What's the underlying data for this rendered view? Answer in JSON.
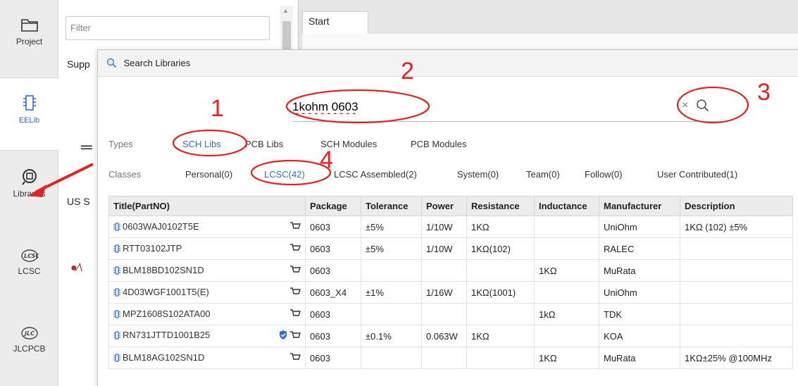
{
  "rail": {
    "items": [
      {
        "label": "Project",
        "icon": "folder-icon"
      },
      {
        "label": "EELib",
        "icon": "chip-icon"
      },
      {
        "label": "Libraries",
        "icon": "libraries-icon"
      },
      {
        "label": "LCSC",
        "icon": "lcsc-logo-icon"
      },
      {
        "label": "JLCPCB",
        "icon": "jlc-logo-icon"
      }
    ]
  },
  "left_panel": {
    "filter_placeholder": "Filter",
    "supp_text": "Supp",
    "uss_text": "US S"
  },
  "tabs": {
    "start": "Start"
  },
  "dialog": {
    "title": "Search Libraries",
    "search_value": "1kohm 0603",
    "clear_glyph": "×",
    "types_label": "Types",
    "types": [
      "SCH Libs",
      "PCB Libs",
      "SCH Modules",
      "PCB Modules"
    ],
    "selected_type": "SCH Libs",
    "classes_label": "Classes",
    "classes": [
      "Personal(0)",
      "LCSC(42)",
      "LCSC Assembled(2)",
      "System(0)",
      "Team(0)",
      "Follow(0)",
      "User Contributed(1)"
    ],
    "selected_class": "LCSC(42)",
    "accent": "#2f6fd8"
  },
  "table": {
    "headers": [
      "Title(PartNO)",
      "Package",
      "Tolerance",
      "Power",
      "Resistance",
      "Inductance",
      "Manufacturer",
      "Description"
    ],
    "rows": [
      {
        "title": "0603WAJ0102T5E",
        "verified": false,
        "package": "0603",
        "tolerance": "±5%",
        "power": "1/10W",
        "resistance": "1KΩ",
        "inductance": "",
        "manufacturer": "UniOhm",
        "description": "1KΩ (102) ±5%"
      },
      {
        "title": "RTT03102JTP",
        "verified": false,
        "package": "0603",
        "tolerance": "±5%",
        "power": "1/10W",
        "resistance": "1KΩ(102)",
        "inductance": "",
        "manufacturer": "RALEC",
        "description": ""
      },
      {
        "title": "BLM18BD102SN1D",
        "verified": false,
        "package": "0603",
        "tolerance": "",
        "power": "",
        "resistance": "",
        "inductance": "1KΩ",
        "manufacturer": "MuRata",
        "description": ""
      },
      {
        "title": "4D03WGF1001T5(E)",
        "verified": false,
        "package": "0603_X4",
        "tolerance": "±1%",
        "power": "1/16W",
        "resistance": "1KΩ(1001)",
        "inductance": "",
        "manufacturer": "UniOhm",
        "description": ""
      },
      {
        "title": "MPZ1608S102ATA00",
        "verified": false,
        "package": "0603",
        "tolerance": "",
        "power": "",
        "resistance": "",
        "inductance": "1kΩ",
        "manufacturer": "TDK",
        "description": ""
      },
      {
        "title": "RN731JTTD1001B25",
        "verified": true,
        "package": "0603",
        "tolerance": "±0.1%",
        "power": "0.063W",
        "resistance": "1KΩ",
        "inductance": "",
        "manufacturer": "KOA",
        "description": ""
      },
      {
        "title": "BLM18AG102SN1D",
        "verified": false,
        "package": "0603",
        "tolerance": "",
        "power": "",
        "resistance": "",
        "inductance": "1KΩ",
        "manufacturer": "MuRata",
        "description": "1KΩ±25% @100MHz"
      }
    ]
  },
  "annotations": {
    "numbers": [
      "1",
      "2",
      "3",
      "4"
    ],
    "color": "#e52222"
  }
}
